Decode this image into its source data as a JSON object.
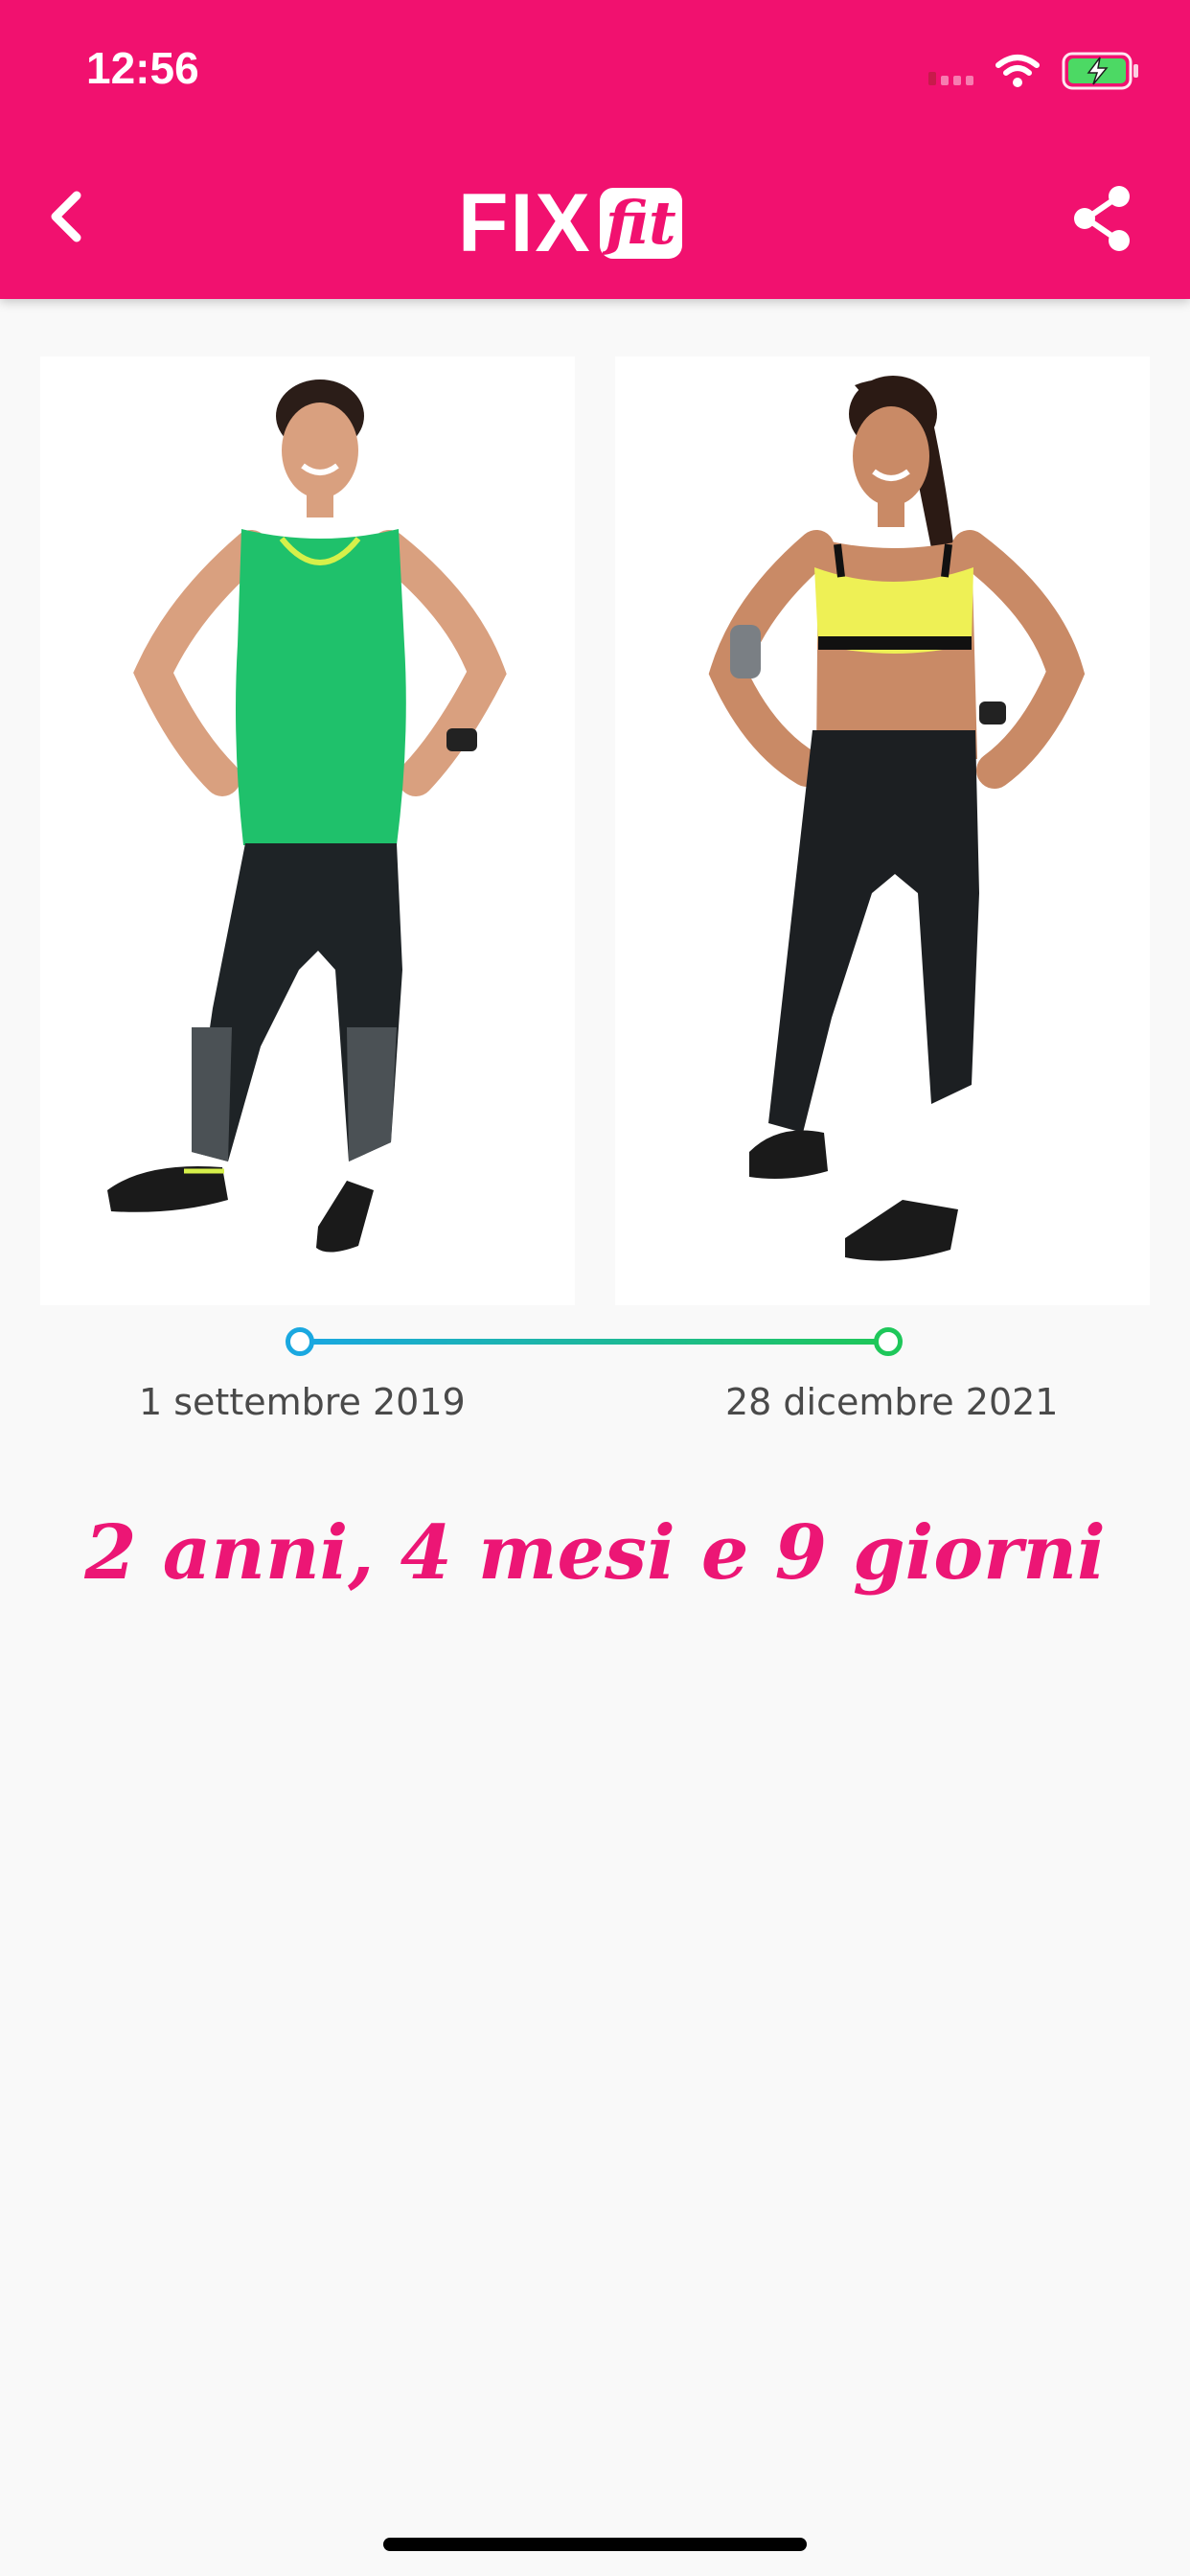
{
  "status_bar": {
    "time": "12:56",
    "icons": [
      "cellular-signal-icon",
      "wifi-icon",
      "battery-charging-icon"
    ]
  },
  "header": {
    "logo_part1": "FIX",
    "logo_part2": "fit",
    "back_icon": "chevron-left-icon",
    "share_icon": "share-icon",
    "background_color": "#f1116f"
  },
  "comparison": {
    "before_photo": "before-photo",
    "after_photo": "after-photo",
    "start_date": "1 settembre 2019",
    "end_date": "28 dicembre 2021",
    "duration": "2 anni, 4 mesi e 9 giorni",
    "timeline_colors": {
      "start": "#1aa8e0",
      "end": "#1ec75a"
    }
  }
}
